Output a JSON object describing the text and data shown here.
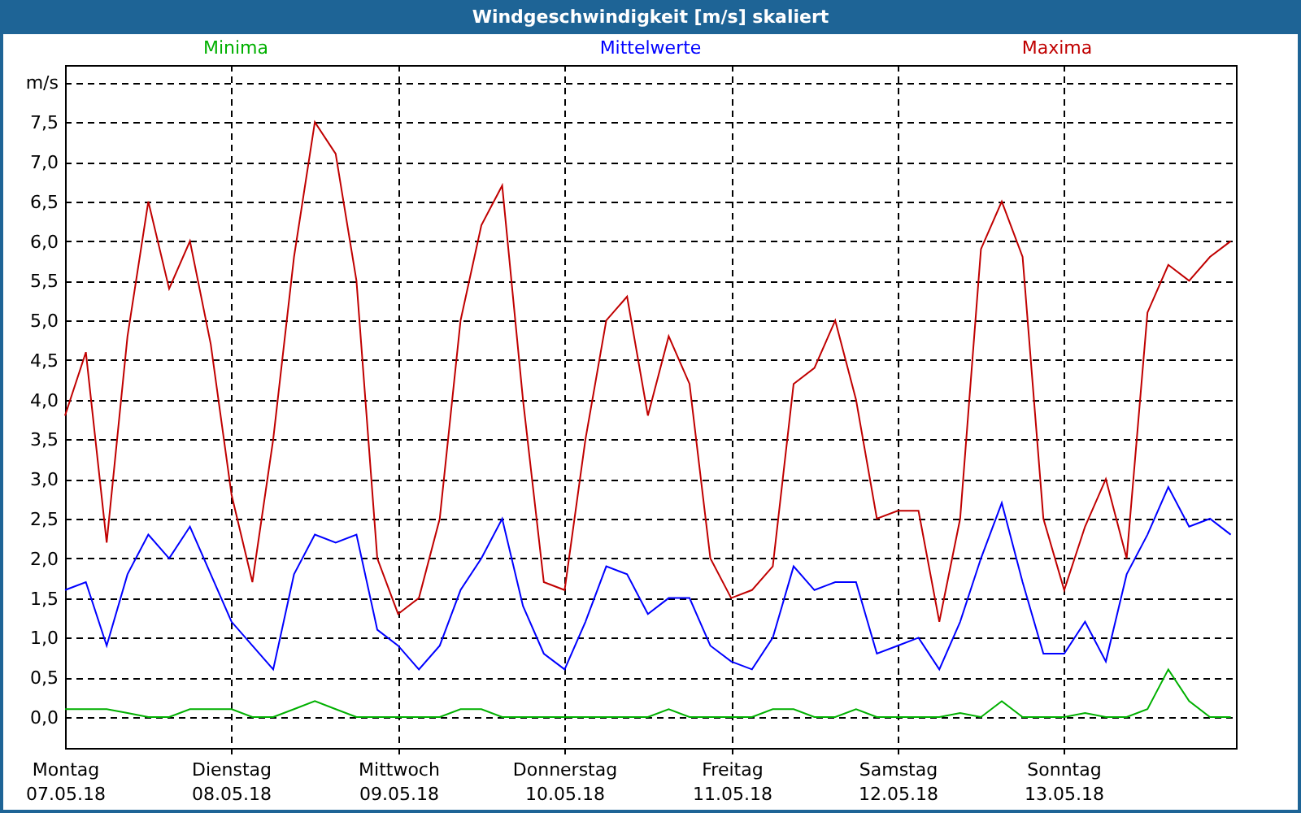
{
  "window": {
    "title": "Windgeschwindigkeit [m/s] skaliert"
  },
  "chart": {
    "chart_data": {
      "type": "line",
      "grid": true,
      "ylabel": "m/s",
      "ylim": [
        -0.39,
        8.22
      ],
      "categories": [
        "Montag\n07.05.18",
        null,
        null,
        null,
        null,
        null,
        null,
        null,
        "Dienstag\n08.05.18",
        null,
        null,
        null,
        null,
        null,
        null,
        null,
        "Mittwoch\n09.05.18",
        null,
        null,
        null,
        null,
        null,
        null,
        null,
        "Donnerstag\n10.05.18",
        null,
        null,
        null,
        null,
        null,
        null,
        null,
        "Freitag\n11.05.18",
        null,
        null,
        null,
        null,
        null,
        null,
        null,
        "Samstag\n12.05.18",
        null,
        null,
        null,
        null,
        null,
        null,
        null,
        "Sonntag\n13.05.18",
        null,
        null,
        null,
        null,
        null,
        null,
        null,
        null
      ],
      "series": [
        {
          "name": "Minima",
          "color": "#00b000",
          "values": [
            0.1,
            0.1,
            0.1,
            0.05,
            0,
            0,
            0.1,
            0.1,
            0.1,
            0,
            0,
            0.1,
            0.2,
            0.1,
            0,
            0,
            0,
            0,
            0,
            0.1,
            0.1,
            0,
            0,
            0,
            0,
            0,
            0,
            0,
            0,
            0.1,
            0,
            0,
            0,
            0,
            0.1,
            0.1,
            0,
            0,
            0.1,
            0,
            0,
            0,
            0,
            0.05,
            0,
            0.2,
            0,
            0,
            0,
            0.05,
            0,
            0,
            0.1,
            0.6,
            0.2,
            0,
            0
          ]
        },
        {
          "name": "Mittelwerte",
          "color": "#0000ff",
          "values": [
            1.6,
            1.7,
            0.9,
            1.8,
            2.3,
            2.0,
            2.4,
            1.8,
            1.2,
            0.9,
            0.6,
            1.8,
            2.3,
            2.2,
            2.3,
            1.1,
            0.9,
            0.6,
            0.9,
            1.6,
            2.0,
            2.5,
            1.4,
            0.8,
            0.6,
            1.2,
            1.9,
            1.8,
            1.3,
            1.5,
            1.5,
            0.9,
            0.7,
            0.6,
            1.0,
            1.9,
            1.6,
            1.7,
            1.7,
            0.8,
            0.9,
            1.0,
            0.6,
            1.2,
            2.0,
            2.7,
            1.7,
            0.8,
            0.8,
            1.2,
            0.7,
            1.8,
            2.3,
            2.9,
            2.4,
            2.5,
            2.3
          ]
        },
        {
          "name": "Maxima",
          "color": "#c00000",
          "values": [
            3.8,
            4.6,
            2.2,
            4.8,
            6.5,
            5.4,
            6.0,
            4.7,
            2.8,
            1.7,
            3.5,
            5.8,
            7.5,
            7.1,
            5.5,
            2.0,
            1.3,
            1.5,
            2.5,
            5.0,
            6.2,
            6.7,
            4.0,
            1.7,
            1.6,
            3.5,
            5.0,
            5.3,
            3.8,
            4.8,
            4.2,
            2.0,
            1.5,
            1.6,
            1.9,
            4.2,
            4.4,
            5.0,
            4.0,
            2.5,
            2.6,
            2.6,
            1.2,
            2.5,
            5.9,
            6.5,
            5.8,
            2.5,
            1.6,
            2.4,
            3.0,
            2.0,
            5.1,
            5.7,
            5.5,
            5.8,
            6.0
          ]
        }
      ],
      "yticks": [
        {
          "value": 0,
          "label": "0,0"
        },
        {
          "value": 0.5,
          "label": "0,5"
        },
        {
          "value": 1,
          "label": "1,0"
        },
        {
          "value": 1.5,
          "label": "1,5"
        },
        {
          "value": 2,
          "label": "2,0"
        },
        {
          "value": 2.5,
          "label": "2,5"
        },
        {
          "value": 3,
          "label": "3,0"
        },
        {
          "value": 3.5,
          "label": "3,5"
        },
        {
          "value": 4,
          "label": "4,0"
        },
        {
          "value": 4.5,
          "label": "4,5"
        },
        {
          "value": 5,
          "label": "5,0"
        },
        {
          "value": 5.5,
          "label": "5,5"
        },
        {
          "value": 6,
          "label": "6,0"
        },
        {
          "value": 6.5,
          "label": "6,5"
        },
        {
          "value": 7,
          "label": "7,0"
        },
        {
          "value": 7.5,
          "label": "7,5"
        }
      ]
    }
  }
}
